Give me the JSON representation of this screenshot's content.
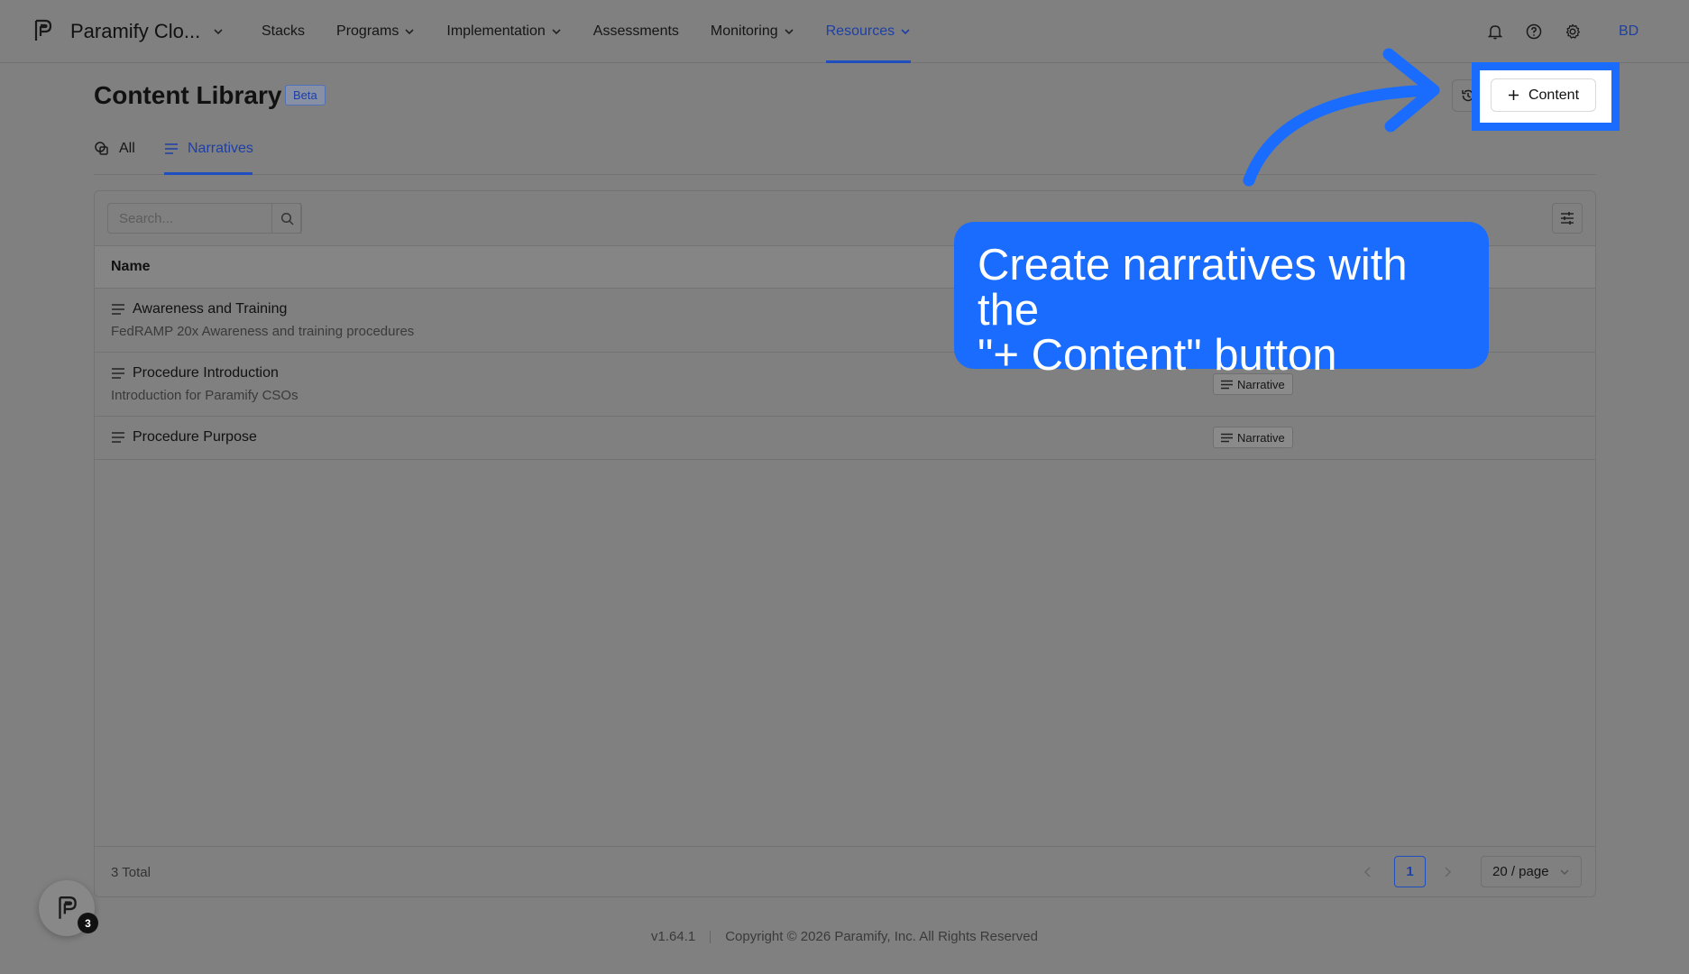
{
  "nav": {
    "org_name": "Paramify Clo...",
    "items": [
      {
        "label": "Stacks",
        "has_dropdown": false,
        "active": false
      },
      {
        "label": "Programs",
        "has_dropdown": true,
        "active": false
      },
      {
        "label": "Implementation",
        "has_dropdown": true,
        "active": false
      },
      {
        "label": "Assessments",
        "has_dropdown": false,
        "active": false
      },
      {
        "label": "Monitoring",
        "has_dropdown": true,
        "active": false
      },
      {
        "label": "Resources",
        "has_dropdown": true,
        "active": true
      }
    ],
    "icons": [
      "bell-icon",
      "help-icon",
      "gear-icon"
    ],
    "avatar_initials": "BD"
  },
  "header": {
    "title": "Content Library",
    "badge": "Beta",
    "add_button_label": "Content"
  },
  "tabs": [
    {
      "label": "All",
      "icon": "all-icon",
      "active": false
    },
    {
      "label": "Narratives",
      "icon": "lines-icon",
      "active": true
    }
  ],
  "table": {
    "search_placeholder": "Search...",
    "column_name": "Name",
    "rows": [
      {
        "title": "Awareness and Training",
        "description": "FedRAMP 20x Awareness and training procedures",
        "type": ""
      },
      {
        "title": "Procedure Introduction",
        "description": "Introduction for Paramify CSOs",
        "type": "Narrative"
      },
      {
        "title": "Procedure Purpose",
        "description": "",
        "type": "Narrative"
      }
    ],
    "total": "3 Total",
    "current_page": "1",
    "page_size": "20 / page"
  },
  "footer": {
    "version": "v1.64.1",
    "copyright": "Copyright © 2026 Paramify, Inc. All Rights Reserved"
  },
  "widget": {
    "badge_count": "3"
  },
  "annotation": {
    "callout_line1": "Create narratives with the",
    "callout_line2": "\"+ Content\" button",
    "color": "#1a6cff"
  }
}
